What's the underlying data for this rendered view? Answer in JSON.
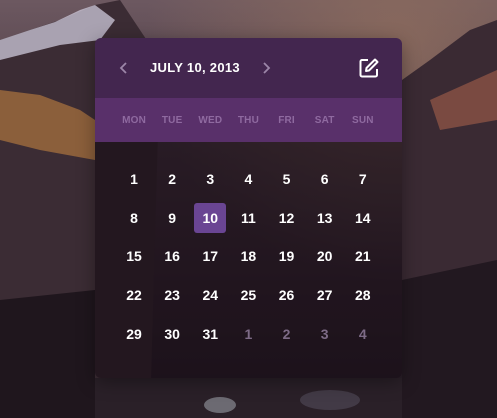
{
  "calendar": {
    "title": "JULY 10, 2013",
    "prev_icon": "chevron-left-icon",
    "next_icon": "chevron-right-icon",
    "edit_icon": "edit-icon",
    "weekdays": [
      "MON",
      "TUE",
      "WED",
      "THU",
      "FRI",
      "SAT",
      "SUN"
    ],
    "selected_day": "10",
    "accent_color": "#6a4593",
    "header_color": "#43264f",
    "weekday_bar_color": "#59306a",
    "weeks": [
      [
        "1",
        "2",
        "3",
        "4",
        "5",
        "6",
        "7"
      ],
      [
        "8",
        "9",
        "10",
        "11",
        "12",
        "13",
        "14"
      ],
      [
        "15",
        "16",
        "17",
        "18",
        "19",
        "20",
        "21"
      ],
      [
        "22",
        "23",
        "24",
        "25",
        "26",
        "27",
        "28"
      ],
      [
        "29",
        "30",
        "31",
        "1",
        "2",
        "3",
        "4"
      ]
    ]
  }
}
